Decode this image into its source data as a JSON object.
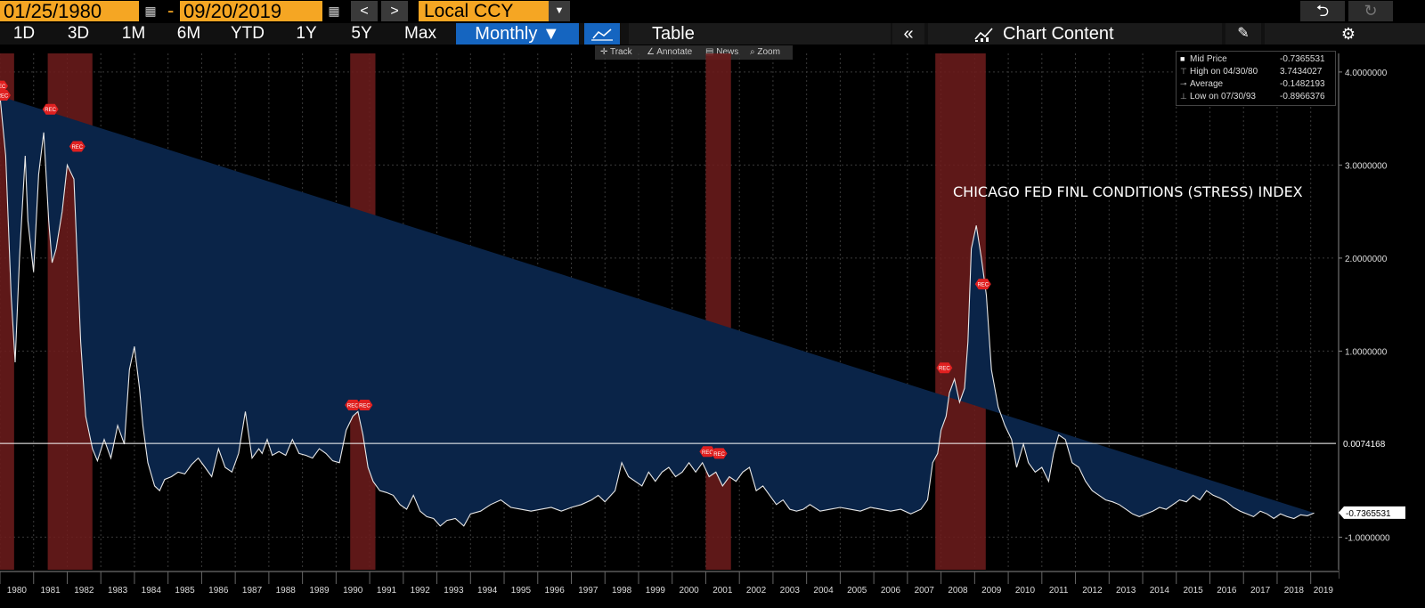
{
  "toolbar": {
    "start_date": "01/25/1980",
    "end_date": "09/20/2019",
    "currency": "Local CCY",
    "prev": "<",
    "next": ">",
    "dash": "-",
    "undo": "⮌",
    "redo": "↻"
  },
  "ranges": [
    "1D",
    "3D",
    "1M",
    "6M",
    "YTD",
    "1Y",
    "5Y",
    "Max"
  ],
  "period": "Monthly ▼",
  "table_label": "Table",
  "collapse_label": "«",
  "chart_content_label": "Chart Content",
  "subtools": {
    "track": "Track",
    "annotate": "Annotate",
    "news": "News",
    "zoom": "Zoom"
  },
  "legend": {
    "mid_label": "Mid Price",
    "mid_value": "-0.7365531",
    "high_label": "High on 04/30/80",
    "high_value": "3.7434027",
    "avg_label": "Average",
    "avg_value": "-0.1482193",
    "low_label": "Low on 07/30/93",
    "low_value": "-0.8966376"
  },
  "colors": {
    "accent": "#f5a623",
    "selected": "#1565c0",
    "area": "#0a2448",
    "recession": "#7a1f1f"
  },
  "chart_data": {
    "type": "area",
    "title": "CHICAGO FED FINL CONDITIONS (STRESS) INDEX",
    "xlabel": "",
    "ylabel": "",
    "ylim": [
      -1.35,
      4.2
    ],
    "xlim": [
      1980.0,
      2019.75
    ],
    "grid": true,
    "yticks": [
      -1,
      1,
      2,
      3,
      4
    ],
    "ytick_labels": [
      "-1.0000000",
      "1.0000000",
      "2.0000000",
      "3.0000000",
      "4.0000000"
    ],
    "xticks": [
      "1980",
      "1981",
      "1982",
      "1983",
      "1984",
      "1985",
      "1986",
      "1987",
      "1988",
      "1989",
      "1990",
      "1991",
      "1992",
      "1993",
      "1994",
      "1995",
      "1996",
      "1997",
      "1998",
      "1999",
      "2000",
      "2001",
      "2002",
      "2003",
      "2004",
      "2005",
      "2006",
      "2007",
      "2008",
      "2009",
      "2010",
      "2011",
      "2012",
      "2013",
      "2014",
      "2015",
      "2016",
      "2017",
      "2018",
      "2019"
    ],
    "reference_line": {
      "value": 0.0074168,
      "label": "0.0074168"
    },
    "last_value": {
      "value": -0.7365531,
      "label": "-0.7365531"
    },
    "recessions": [
      [
        1980.0,
        1980.42
      ],
      [
        1981.42,
        1982.75
      ],
      [
        1990.42,
        1991.17
      ],
      [
        2001.0,
        2001.75
      ],
      [
        2007.83,
        2009.33
      ]
    ],
    "rec_marker": "REC",
    "rec_markers": [
      {
        "x": 1980.0,
        "y": 3.85
      },
      {
        "x": 1980.08,
        "y": 3.75
      },
      {
        "x": 1981.5,
        "y": 3.6
      },
      {
        "x": 1982.3,
        "y": 3.2
      },
      {
        "x": 1990.5,
        "y": 0.42
      },
      {
        "x": 1990.85,
        "y": 0.42
      },
      {
        "x": 2001.05,
        "y": -0.08
      },
      {
        "x": 2001.4,
        "y": -0.1
      },
      {
        "x": 2008.1,
        "y": 0.82
      },
      {
        "x": 2009.25,
        "y": 1.72
      }
    ],
    "x": [
      1980.0,
      1980.17,
      1980.33,
      1980.45,
      1980.58,
      1980.75,
      1980.83,
      1981.0,
      1981.15,
      1981.3,
      1981.45,
      1981.55,
      1981.67,
      1981.85,
      1982.0,
      1982.2,
      1982.4,
      1982.55,
      1982.75,
      1982.9,
      1983.1,
      1983.3,
      1983.5,
      1983.7,
      1983.85,
      1984.0,
      1984.15,
      1984.25,
      1984.4,
      1984.6,
      1984.75,
      1984.9,
      1985.1,
      1985.3,
      1985.5,
      1985.7,
      1985.9,
      1986.1,
      1986.3,
      1986.5,
      1986.7,
      1986.9,
      1987.1,
      1987.3,
      1987.5,
      1987.7,
      1987.8,
      1987.95,
      1988.1,
      1988.3,
      1988.5,
      1988.7,
      1988.9,
      1989.1,
      1989.3,
      1989.5,
      1989.7,
      1989.9,
      1990.1,
      1990.3,
      1990.5,
      1990.65,
      1990.8,
      1990.95,
      1991.1,
      1991.3,
      1991.5,
      1991.7,
      1991.9,
      1992.1,
      1992.3,
      1992.5,
      1992.7,
      1992.9,
      1993.1,
      1993.3,
      1993.55,
      1993.8,
      1994.0,
      1994.3,
      1994.6,
      1994.9,
      1995.2,
      1995.5,
      1995.8,
      1996.1,
      1996.4,
      1996.7,
      1997.0,
      1997.3,
      1997.6,
      1997.8,
      1998.0,
      1998.3,
      1998.5,
      1998.7,
      1998.9,
      1999.1,
      1999.3,
      1999.5,
      1999.7,
      1999.9,
      2000.1,
      2000.3,
      2000.5,
      2000.7,
      2000.9,
      2001.1,
      2001.3,
      2001.5,
      2001.7,
      2001.9,
      2002.1,
      2002.3,
      2002.5,
      2002.7,
      2002.9,
      2003.1,
      2003.3,
      2003.5,
      2003.7,
      2003.9,
      2004.1,
      2004.4,
      2004.7,
      2005.0,
      2005.3,
      2005.6,
      2005.9,
      2006.2,
      2006.5,
      2006.8,
      2007.1,
      2007.4,
      2007.6,
      2007.75,
      2007.9,
      2008.0,
      2008.15,
      2008.25,
      2008.4,
      2008.55,
      2008.7,
      2008.8,
      2008.9,
      2009.05,
      2009.2,
      2009.35,
      2009.5,
      2009.7,
      2009.9,
      2010.1,
      2010.25,
      2010.45,
      2010.6,
      2010.8,
      2011.0,
      2011.2,
      2011.35,
      2011.5,
      2011.7,
      2011.9,
      2012.1,
      2012.3,
      2012.5,
      2012.7,
      2012.9,
      2013.1,
      2013.3,
      2013.5,
      2013.7,
      2013.9,
      2014.1,
      2014.3,
      2014.5,
      2014.7,
      2014.9,
      2015.1,
      2015.3,
      2015.5,
      2015.7,
      2015.9,
      2016.1,
      2016.3,
      2016.5,
      2016.7,
      2016.9,
      2017.1,
      2017.3,
      2017.5,
      2017.7,
      2017.9,
      2018.1,
      2018.3,
      2018.5,
      2018.7,
      2018.9,
      2019.1,
      2019.3,
      2019.5,
      2019.7
    ],
    "values": [
      3.74,
      3.1,
      1.6,
      0.88,
      2.0,
      3.1,
      2.4,
      1.85,
      2.9,
      3.35,
      2.4,
      1.95,
      2.1,
      2.5,
      3.0,
      2.85,
      1.1,
      0.3,
      -0.05,
      -0.18,
      0.05,
      -0.15,
      0.2,
      0.0,
      0.8,
      1.05,
      0.6,
      0.2,
      -0.2,
      -0.45,
      -0.5,
      -0.38,
      -0.35,
      -0.3,
      -0.32,
      -0.22,
      -0.15,
      -0.25,
      -0.35,
      -0.05,
      -0.25,
      -0.3,
      -0.1,
      0.35,
      -0.15,
      -0.05,
      -0.1,
      0.05,
      -0.12,
      -0.08,
      -0.12,
      0.05,
      -0.1,
      -0.12,
      -0.15,
      -0.05,
      -0.1,
      -0.18,
      -0.2,
      0.15,
      0.3,
      0.35,
      0.1,
      -0.25,
      -0.4,
      -0.5,
      -0.52,
      -0.55,
      -0.65,
      -0.7,
      -0.55,
      -0.72,
      -0.78,
      -0.8,
      -0.88,
      -0.82,
      -0.8,
      -0.88,
      -0.75,
      -0.72,
      -0.65,
      -0.6,
      -0.68,
      -0.7,
      -0.72,
      -0.7,
      -0.68,
      -0.72,
      -0.68,
      -0.65,
      -0.6,
      -0.55,
      -0.62,
      -0.5,
      -0.2,
      -0.35,
      -0.4,
      -0.45,
      -0.3,
      -0.4,
      -0.3,
      -0.25,
      -0.35,
      -0.3,
      -0.2,
      -0.3,
      -0.2,
      -0.35,
      -0.3,
      -0.45,
      -0.35,
      -0.4,
      -0.3,
      -0.25,
      -0.5,
      -0.45,
      -0.55,
      -0.65,
      -0.6,
      -0.7,
      -0.72,
      -0.7,
      -0.65,
      -0.72,
      -0.7,
      -0.68,
      -0.7,
      -0.72,
      -0.68,
      -0.7,
      -0.72,
      -0.7,
      -0.75,
      -0.7,
      -0.6,
      -0.2,
      -0.1,
      0.15,
      0.3,
      0.55,
      0.7,
      0.45,
      0.6,
      1.1,
      2.1,
      2.35,
      2.0,
      1.6,
      0.8,
      0.4,
      0.2,
      0.05,
      -0.25,
      0.0,
      -0.2,
      -0.3,
      -0.25,
      -0.4,
      -0.1,
      0.1,
      0.05,
      -0.2,
      -0.25,
      -0.4,
      -0.5,
      -0.55,
      -0.6,
      -0.62,
      -0.65,
      -0.7,
      -0.75,
      -0.78,
      -0.75,
      -0.72,
      -0.68,
      -0.7,
      -0.65,
      -0.6,
      -0.62,
      -0.55,
      -0.6,
      -0.5,
      -0.55,
      -0.58,
      -0.62,
      -0.68,
      -0.72,
      -0.75,
      -0.78,
      -0.72,
      -0.75,
      -0.8,
      -0.75,
      -0.78,
      -0.8,
      -0.76,
      -0.77,
      -0.74
    ]
  }
}
